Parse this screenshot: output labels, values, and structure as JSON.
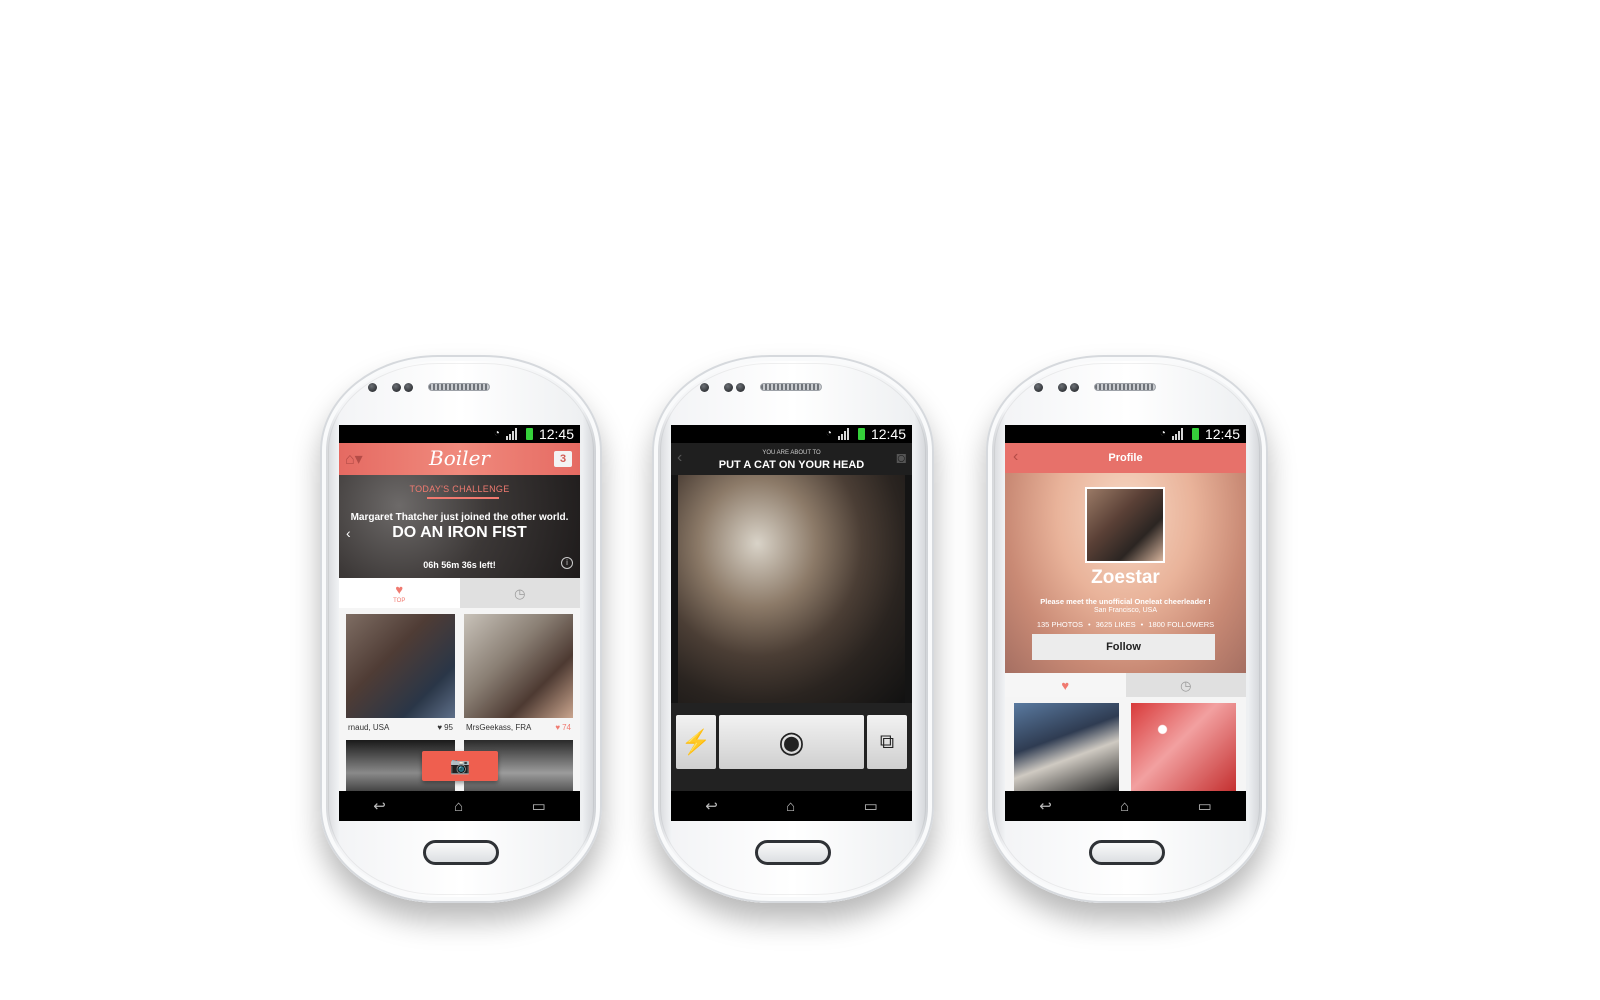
{
  "status": {
    "time": "12:45"
  },
  "screen_home": {
    "logo": "Boiler",
    "notification_count": "3",
    "challenge": {
      "label": "TODAY'S CHALLENGE",
      "subtitle": "Margaret Thatcher just joined the other world.",
      "title": "DO AN IRON FIST",
      "timer": "06h 56m 36s left!"
    },
    "tabs": {
      "top_label": "TOP"
    },
    "feed": [
      {
        "user": "rnaud, USA",
        "likes": "95"
      },
      {
        "user": "MrsGeekass, FRA",
        "likes": "74"
      }
    ]
  },
  "screen_camera": {
    "subtitle": "YOU ARE ABOUT TO",
    "title": "PUT A CAT ON YOUR HEAD"
  },
  "screen_profile": {
    "header_title": "Profile",
    "name": "Zoestar",
    "bio": "Please meet the unofficial Oneleat cheerleader !",
    "location": "San Francisco, USA",
    "stats": {
      "photos": "135 PHOTOS",
      "likes": "3625 LIKES",
      "followers": "1800 FOLLOWERS"
    },
    "follow_label": "Follow"
  },
  "colors": {
    "accent": "#e7716a",
    "capture": "#ef5f4f",
    "battery": "#35d13a"
  },
  "icons": [
    "home-icon",
    "heart-icon",
    "clock-icon",
    "camera-icon",
    "flash-icon",
    "switch-camera-icon",
    "back-icon",
    "info-icon",
    "wifi-icon",
    "signal-icon",
    "battery-icon",
    "nav-back-icon",
    "nav-home-icon",
    "nav-recent-icon"
  ]
}
